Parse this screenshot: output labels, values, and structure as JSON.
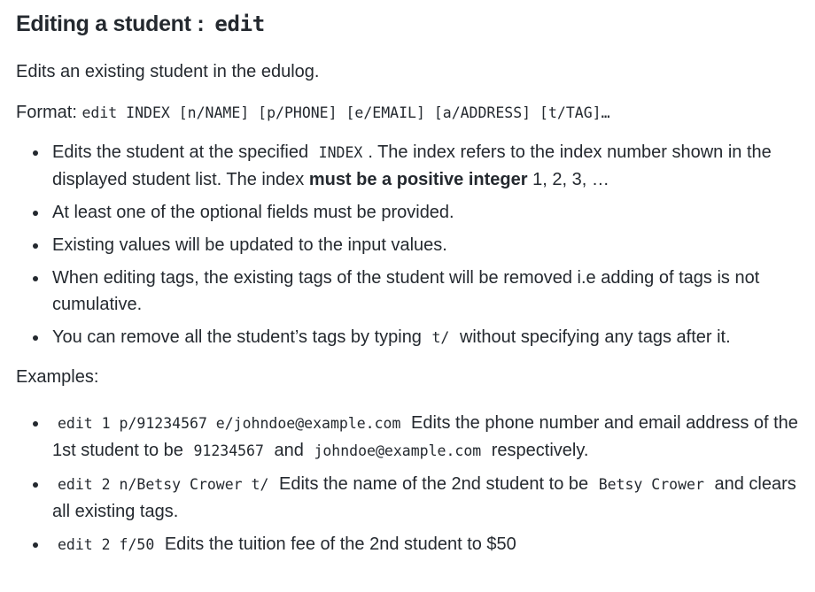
{
  "heading": {
    "text": "Editing a student :",
    "code": "edit"
  },
  "intro": "Edits an existing student in the edulog.",
  "format": {
    "label": "Format:",
    "code": "edit INDEX [n/NAME] [p/PHONE] [e/EMAIL] [a/ADDRESS] [t/TAG]…"
  },
  "details": [
    {
      "t1": "Edits the student at the specified",
      "code": "INDEX",
      "t2": ". The index refers to the index number shown in the displayed student list. The index",
      "bold": "must be a positive integer",
      "t3": "1, 2, 3, …"
    },
    {
      "text": "At least one of the optional fields must be provided."
    },
    {
      "text": "Existing values will be updated to the input values."
    },
    {
      "text": "When editing tags, the existing tags of the student will be removed i.e adding of tags is not cumulative."
    },
    {
      "t1": "You can remove all the student’s tags by typing",
      "code": "t/",
      "t2": "without specifying any tags after it."
    }
  ],
  "examples_label": "Examples:",
  "examples": [
    {
      "cmd": "edit 1 p/91234567 e/johndoe@example.com",
      "t1": "Edits the phone number and email address of the 1st student to be",
      "code1": "91234567",
      "t2": "and",
      "code2": "johndoe@example.com",
      "t3": "respectively."
    },
    {
      "cmd": "edit 2 n/Betsy Crower t/",
      "t1": "Edits the name of the 2nd student to be",
      "code1": "Betsy Crower",
      "t2": "and clears all existing tags."
    },
    {
      "cmd": "edit 2 f/50",
      "t1": "Edits the tuition fee of the 2nd student to $50"
    }
  ]
}
